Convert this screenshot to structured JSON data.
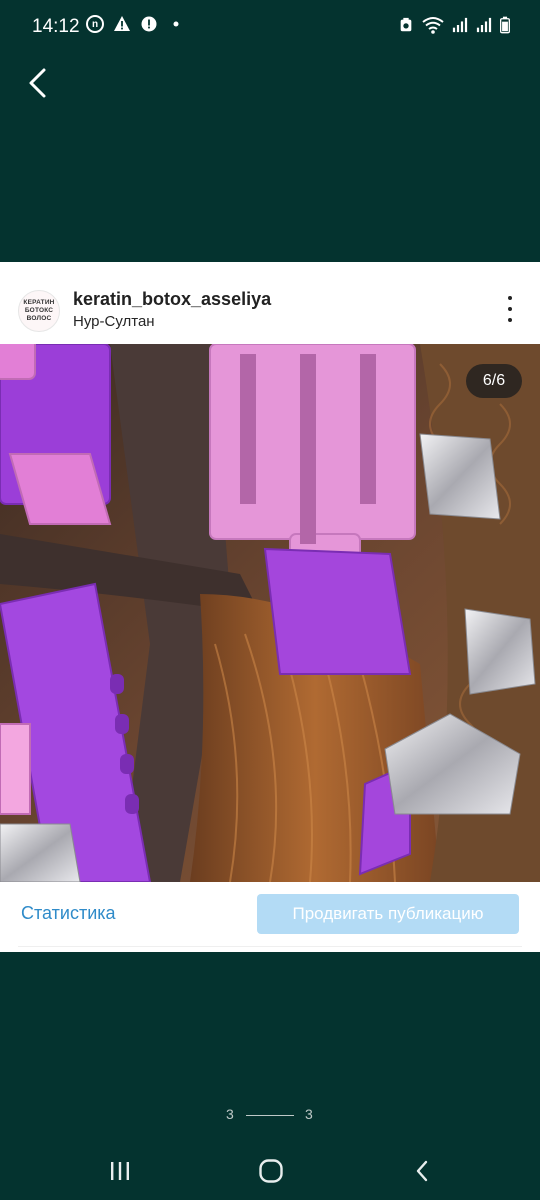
{
  "status_bar": {
    "time": "14:12",
    "left_icons": [
      "n-notification-icon",
      "warning-icon",
      "alert-icon",
      "dot-icon"
    ],
    "right_icons": [
      "battery-saver-icon",
      "wifi-icon",
      "signal-icon",
      "signal-icon",
      "battery-icon"
    ]
  },
  "nav": {
    "back_icon": "chevron-left-icon"
  },
  "post": {
    "avatar_logo_text": "КЕРАТИН БОТОКС ВОЛОС",
    "username": "keratin_botox_asseliya",
    "location": "Нур-Султан",
    "more_icon": "more-vertical-icon",
    "image_counter": "6/6"
  },
  "actions": {
    "statistics_label": "Статистика",
    "promote_label": "Продвигать публикацию"
  },
  "pager": {
    "left": "3",
    "right": "3"
  },
  "system_nav": {
    "recents": "recents-icon",
    "home": "home-icon",
    "back": "back-icon"
  },
  "colors": {
    "background": "#04332f",
    "link": "#2f8bc9",
    "promote_button": "#b3dbf5"
  }
}
